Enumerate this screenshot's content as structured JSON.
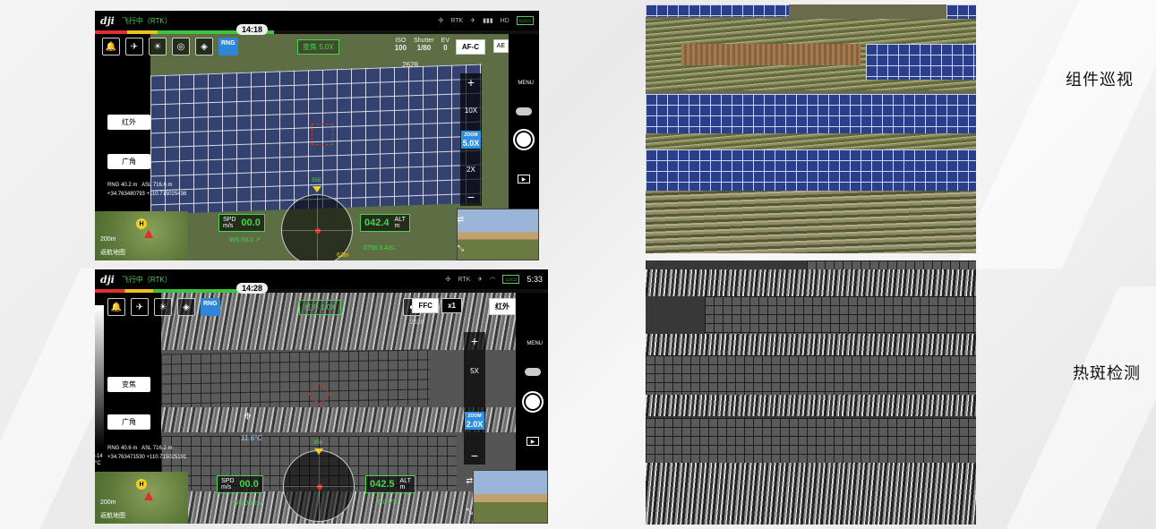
{
  "captions": {
    "top": "组件巡视",
    "bottom": "热斑检测"
  },
  "colors": {
    "accent_green": "#4bd44b",
    "rng_blue": "#2f86d8",
    "zoom_blue": "#2f8fe0"
  },
  "top_app": {
    "logo": "dji",
    "flight_status": "飞行中（RTK）",
    "rtk": "RTK",
    "hd": "HD",
    "timer": "14:18",
    "rng_btn": "RNG",
    "zoom_label": "变焦 5.0X",
    "iso_label": "ISO",
    "iso": "100",
    "shutter_label": "Shutter",
    "shutter": "1/80",
    "ev_label": "EV",
    "ev": "0",
    "remaining": "2628",
    "af_btn": "AF-C",
    "ae_btn": "AE",
    "btn_ir": "红外",
    "btn_wide": "广角",
    "menu": "MENU",
    "zoom_plus": "+",
    "zoom_10x": "10X",
    "zoom_ind_small": "ZOOM",
    "zoom_ind": "5.0X",
    "zoom_2x": "2X",
    "zoom_minus": "−",
    "rng_label": "RNG",
    "rng_value": "40.2 m",
    "asl_label": "ASL",
    "asl_value": "716.6 m",
    "gps": "+34.763480793 +110.715025436",
    "spd_label": "SPD",
    "spd_unit": "m/s",
    "spd": "00.0",
    "ws": "WS 03.1 ↗",
    "alt": "042.4",
    "alt_label": "ALT",
    "alt_unit": "m",
    "asl_bottom": "0756.5 ASL",
    "heading": "358",
    "dist": "63m",
    "map_scale": "200m",
    "map_label": "返航地图",
    "h_marker": "H"
  },
  "bottom_app": {
    "logo": "dji",
    "flight_status": "飞行中（RTK）",
    "rtk": "RTK",
    "timer": "14:28",
    "clock": "5:33",
    "rng_btn": "RNG",
    "zoom_label": "红外 1.0X",
    "remaining": "2628",
    "ffc": "FFC",
    "x1": "x1",
    "btn_ir_top": "红外",
    "btn_zoom": "变焦",
    "btn_wide": "广角",
    "menu": "MENU",
    "zoom_plus": "+",
    "zoom_5x": "5X",
    "zoom_ind_small": "ZOOM",
    "zoom_ind": "2.0X",
    "zoom_minus": "−",
    "temp": "11.6°C",
    "rng_label": "RNG",
    "rng_value": "40.6 m",
    "asl_label": "ASL",
    "asl_value": "716.2 m",
    "gps": "+34.763471530 +110.715025191",
    "spd_label": "SPD",
    "spd_unit": "m/s",
    "spd": "00.0",
    "ws": "WS 03.2 ↗",
    "alt": "042.5",
    "alt_label": "ALT",
    "alt_unit": "m",
    "vs": "0.0 VS",
    "heading": "358",
    "map_scale": "200m",
    "map_label": "返航地图",
    "h_marker": "H",
    "scale_top": "-14",
    "scale_unit": "°C"
  }
}
